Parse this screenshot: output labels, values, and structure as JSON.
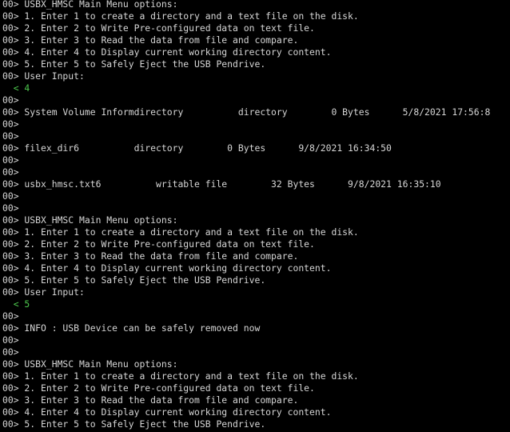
{
  "colors": {
    "background": "#000000",
    "output_text": "#d6d6d6",
    "input_echo": "#4ec94e"
  },
  "console": {
    "lines": [
      {
        "kind": "output",
        "text": "00> USBX_HMSC Main Menu options:"
      },
      {
        "kind": "output",
        "text": "00> 1. Enter 1 to create a directory and a text file on the disk."
      },
      {
        "kind": "output",
        "text": "00> 2. Enter 2 to Write Pre-configured data on text file."
      },
      {
        "kind": "output",
        "text": "00> 3. Enter 3 to Read the data from file and compare."
      },
      {
        "kind": "output",
        "text": "00> 4. Enter 4 to Display current working directory content."
      },
      {
        "kind": "output",
        "text": "00> 5. Enter 5 to Safely Eject the USB Pendrive."
      },
      {
        "kind": "output",
        "text": "00> User Input:"
      },
      {
        "kind": "input",
        "text": "  < 4"
      },
      {
        "kind": "output",
        "text": "00>"
      },
      {
        "kind": "output",
        "text": "00> System Volume Informdirectory          directory        0 Bytes      5/8/2021 17:56:8"
      },
      {
        "kind": "output",
        "text": "00>"
      },
      {
        "kind": "output",
        "text": "00>"
      },
      {
        "kind": "output",
        "text": "00> filex_dir6          directory        0 Bytes      9/8/2021 16:34:50"
      },
      {
        "kind": "output",
        "text": "00>"
      },
      {
        "kind": "output",
        "text": "00>"
      },
      {
        "kind": "output",
        "text": "00> usbx_hmsc.txt6          writable file        32 Bytes      9/8/2021 16:35:10"
      },
      {
        "kind": "output",
        "text": "00>"
      },
      {
        "kind": "output",
        "text": "00>"
      },
      {
        "kind": "output",
        "text": "00> USBX_HMSC Main Menu options:"
      },
      {
        "kind": "output",
        "text": "00> 1. Enter 1 to create a directory and a text file on the disk."
      },
      {
        "kind": "output",
        "text": "00> 2. Enter 2 to Write Pre-configured data on text file."
      },
      {
        "kind": "output",
        "text": "00> 3. Enter 3 to Read the data from file and compare."
      },
      {
        "kind": "output",
        "text": "00> 4. Enter 4 to Display current working directory content."
      },
      {
        "kind": "output",
        "text": "00> 5. Enter 5 to Safely Eject the USB Pendrive."
      },
      {
        "kind": "output",
        "text": "00> User Input:"
      },
      {
        "kind": "input",
        "text": "  < 5"
      },
      {
        "kind": "output",
        "text": "00>"
      },
      {
        "kind": "output",
        "text": "00> INFO : USB Device can be safely removed now"
      },
      {
        "kind": "output",
        "text": "00>"
      },
      {
        "kind": "output",
        "text": "00>"
      },
      {
        "kind": "output",
        "text": "00> USBX_HMSC Main Menu options:"
      },
      {
        "kind": "output",
        "text": "00> 1. Enter 1 to create a directory and a text file on the disk."
      },
      {
        "kind": "output",
        "text": "00> 2. Enter 2 to Write Pre-configured data on text file."
      },
      {
        "kind": "output",
        "text": "00> 3. Enter 3 to Read the data from file and compare."
      },
      {
        "kind": "output",
        "text": "00> 4. Enter 4 to Display current working directory content."
      },
      {
        "kind": "output",
        "text": "00> 5. Enter 5 to Safely Eject the USB Pendrive."
      }
    ]
  }
}
